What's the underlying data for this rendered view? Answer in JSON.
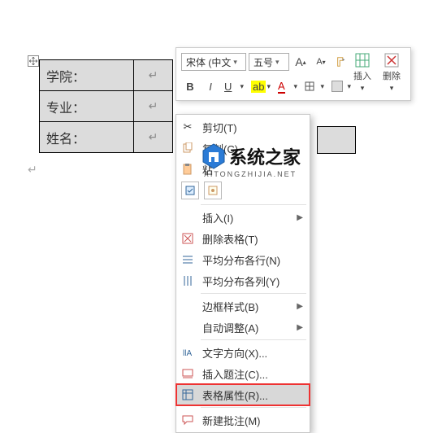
{
  "table": {
    "rows": [
      {
        "label": "学院：",
        "ret": "↵"
      },
      {
        "label": "专业：",
        "ret": "↵"
      },
      {
        "label": "姓名：",
        "ret": "↵"
      }
    ]
  },
  "end_para": "↵",
  "mini": {
    "font_family": "宋体 (中文",
    "font_size": "五号",
    "btn_insert": "插入",
    "btn_delete": "删除",
    "bold": "B",
    "italic": "I",
    "underline": "U",
    "incA": "A",
    "decA": "A",
    "styleA": "A"
  },
  "ctx": {
    "cut": "剪切(T)",
    "copy": "复制(C)",
    "paste_label": "粘",
    "insert": "插入(I)",
    "delete_table": "删除表格(T)",
    "dist_rows": "平均分布各行(N)",
    "dist_cols": "平均分布各列(Y)",
    "border_style": "边框样式(B)",
    "autofit": "自动调整(A)",
    "text_dir": "文字方向(X)...",
    "caption": "插入题注(C)...",
    "table_props": "表格属性(R)...",
    "new_comment": "新建批注(M)"
  },
  "watermark": {
    "title": "系统之家",
    "sub": "XITONGZHIJIA.NET"
  }
}
